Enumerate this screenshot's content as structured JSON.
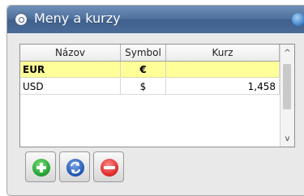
{
  "window": {
    "title": "Meny a kurzy"
  },
  "grid": {
    "columns": [
      "Názov",
      "Symbol",
      "Kurz"
    ],
    "rows": [
      {
        "name": "EUR",
        "symbol": "€",
        "rate": ""
      },
      {
        "name": "USD",
        "symbol": "$",
        "rate": "1,458"
      }
    ]
  },
  "scrollbar": {
    "up_arrow": "^",
    "down_arrow": "v"
  },
  "toolbar": {
    "buttons": [
      "add",
      "refresh",
      "delete"
    ]
  },
  "colors": {
    "titlebar": "#4d6f9c",
    "selected_row": "#ffff99",
    "add": "#24a234",
    "refresh": "#2459b7",
    "delete": "#e02b2b"
  }
}
